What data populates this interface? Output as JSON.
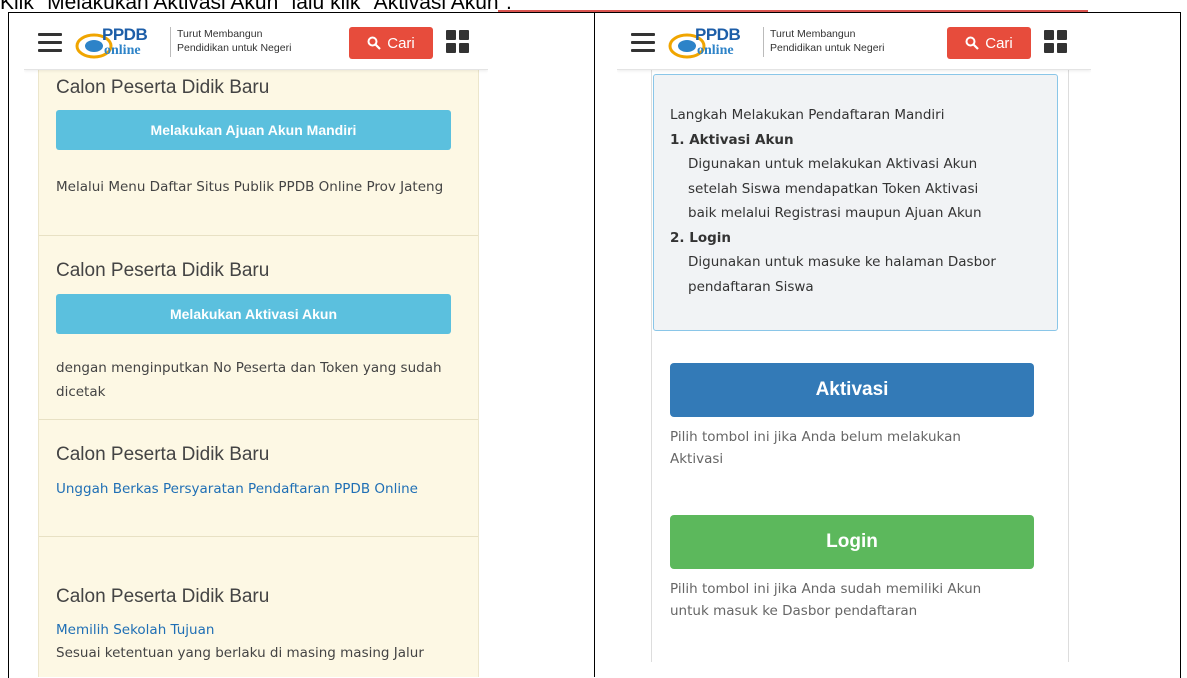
{
  "caption": "Klik \"Melakukan Aktivasi Akun\" lalu klik \"Aktivasi Akun\".",
  "header": {
    "logo_ppdb": "PPDB",
    "logo_online": "online",
    "tagline_line1": "Turut Membangun",
    "tagline_line2": "Pendidikan untuk Negeri",
    "search_label": "Cari",
    "search_color": "#e74c3c"
  },
  "left": {
    "cards": [
      {
        "title": "Calon Peserta Didik Baru",
        "button": "Melakukan Ajuan Akun Mandiri",
        "text": "Melalui Menu Daftar Situs Publik PPDB Online Prov Jateng"
      },
      {
        "title": "Calon Peserta Didik Baru",
        "button": "Melakukan Aktivasi Akun",
        "text": "dengan menginputkan No Peserta dan Token yang sudah dicetak"
      },
      {
        "title": "Calon Peserta Didik Baru",
        "link": "Unggah Berkas Persyaratan Pendaftaran PPDB Online"
      },
      {
        "title": "Calon Peserta Didik Baru",
        "link": "Memilih Sekolah Tujuan",
        "text": "Sesuai ketentuan yang berlaku di masing masing Jalur"
      }
    ]
  },
  "right": {
    "info": {
      "title": "Langkah Melakukan Pendaftaran Mandiri",
      "items": [
        {
          "label": "1. Aktivasi Akun",
          "desc_lines": [
            "Digunakan untuk melakukan Aktivasi Akun",
            "setelah Siswa mendapatkan Token Aktivasi",
            "baik melalui Registrasi maupun Ajuan Akun"
          ]
        },
        {
          "label": "2. Login",
          "desc_lines": [
            "Digunakan untuk masuke ke halaman Dasbor",
            "pendaftaran Siswa"
          ]
        }
      ]
    },
    "aktivasi_button": "Aktivasi",
    "aktivasi_hint_line1": "Pilih tombol ini jika Anda belum melakukan",
    "aktivasi_hint_line2": "Aktivasi",
    "login_button": "Login",
    "login_hint_line1": "Pilih tombol ini jika Anda sudah memiliki Akun",
    "login_hint_line2": "untuk masuk ke Dasbor pendaftaran"
  },
  "colors": {
    "info_button": "#5bc0de",
    "primary_button": "#337ab7",
    "success_button": "#5cb85c",
    "card_background": "#fdf8e4",
    "link": "#1f6fb5"
  }
}
